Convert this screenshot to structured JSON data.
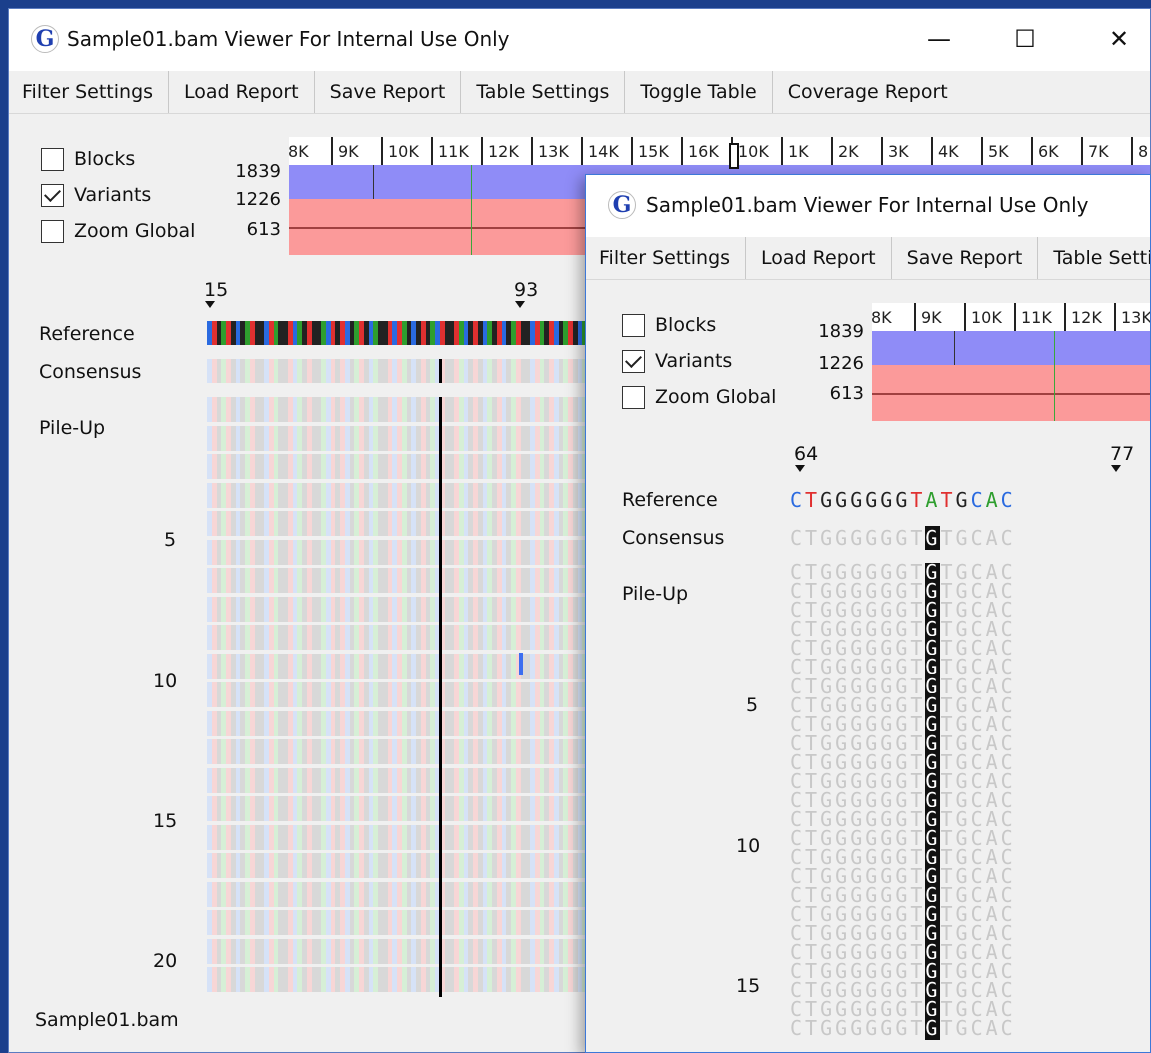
{
  "back_window": {
    "app_icon": "G",
    "title": "Sample01.bam Viewer For Internal Use Only",
    "controls": {
      "minimize": "—",
      "maximize": "☐",
      "close": "✕"
    },
    "menu": [
      "Filter Settings",
      "Load Report",
      "Save Report",
      "Table Settings",
      "Toggle Table",
      "Coverage Report"
    ],
    "options": [
      {
        "label": "Blocks",
        "checked": false
      },
      {
        "label": "Variants",
        "checked": true
      },
      {
        "label": "Zoom Global",
        "checked": false
      }
    ],
    "overview_scale": [
      "1839",
      "1226",
      "613"
    ],
    "overview_ticks": [
      "8K",
      "9K",
      "10K",
      "11K",
      "12K",
      "13K",
      "14K",
      "15K",
      "16K",
      "10K",
      "1K",
      "2K",
      "3K",
      "4K",
      "5K",
      "6K",
      "7K",
      "8"
    ],
    "markers": [
      "15",
      "93"
    ],
    "row_labels": {
      "reference": "Reference",
      "consensus": "Consensus",
      "pileup": "Pile-Up"
    },
    "row_numbers": [
      "5",
      "10",
      "15",
      "20"
    ],
    "file_name": "Sample01.bam"
  },
  "front_window": {
    "app_icon": "G",
    "title": "Sample01.bam Viewer For Internal Use Only",
    "menu": [
      "Filter Settings",
      "Load Report",
      "Save Report",
      "Table Settings"
    ],
    "options": [
      {
        "label": "Blocks",
        "checked": false
      },
      {
        "label": "Variants",
        "checked": true
      },
      {
        "label": "Zoom Global",
        "checked": false
      }
    ],
    "overview_scale": [
      "1839",
      "1226",
      "613"
    ],
    "overview_ticks": [
      "8K",
      "9K",
      "10K",
      "11K",
      "12K",
      "13K"
    ],
    "markers": [
      "64",
      "77"
    ],
    "row_labels": {
      "reference": "Reference",
      "consensus": "Consensus",
      "pileup": "Pile-Up"
    },
    "row_numbers": [
      "5",
      "10",
      "15"
    ],
    "reference_sequence": [
      "C",
      "T",
      "G",
      "G",
      "G",
      "G",
      "G",
      "G",
      "T",
      "A",
      "T",
      "G",
      "C",
      "A",
      "C"
    ],
    "consensus_sequence": [
      "C",
      "T",
      "G",
      "G",
      "G",
      "G",
      "G",
      "G",
      "T",
      "G",
      "T",
      "G",
      "C",
      "A",
      "C"
    ],
    "highlight_index": 9,
    "pileup_read": "CTGGGGGGTGTGCAC",
    "pileup_row_count": 25
  },
  "base_colors": {
    "A": "#2e9e2e",
    "C": "#2a6ae0",
    "G": "#222222",
    "T": "#e03030"
  }
}
